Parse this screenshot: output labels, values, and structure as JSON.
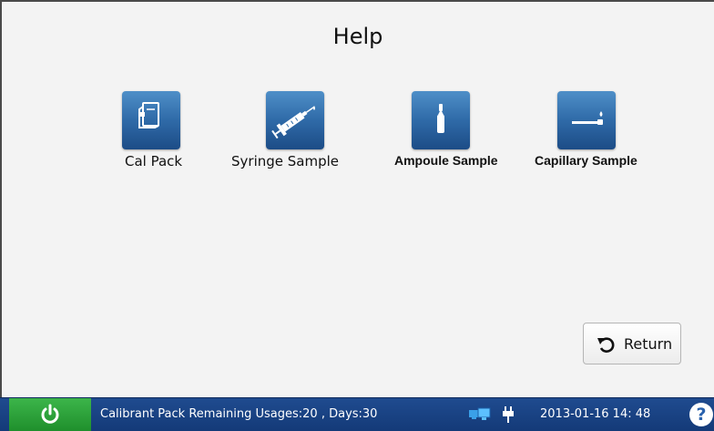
{
  "page": {
    "title": "Help"
  },
  "help_items": [
    {
      "label": "Cal Pack",
      "icon": "cal-pack-icon"
    },
    {
      "label": "Syringe Sample",
      "icon": "syringe-icon"
    },
    {
      "label": "Ampoule Sample",
      "icon": "ampoule-icon"
    },
    {
      "label": "Capillary Sample",
      "icon": "capillary-icon"
    }
  ],
  "return_button": {
    "label": "Return",
    "icon": "return-arrow-icon"
  },
  "status_bar": {
    "message": "Calibrant Pack Remaining Usages:20 , Days:30",
    "datetime": "2013-01-16 14: 48",
    "help_glyph": "?",
    "power_icon": "power-icon",
    "network_icon": "network-icon",
    "plug_icon": "power-plug-icon"
  },
  "colors": {
    "tile_blue": "#2f6aa8",
    "status_bar_blue": "#1f4b8f",
    "power_green": "#2aa33a",
    "background": "#f3f3f3"
  }
}
